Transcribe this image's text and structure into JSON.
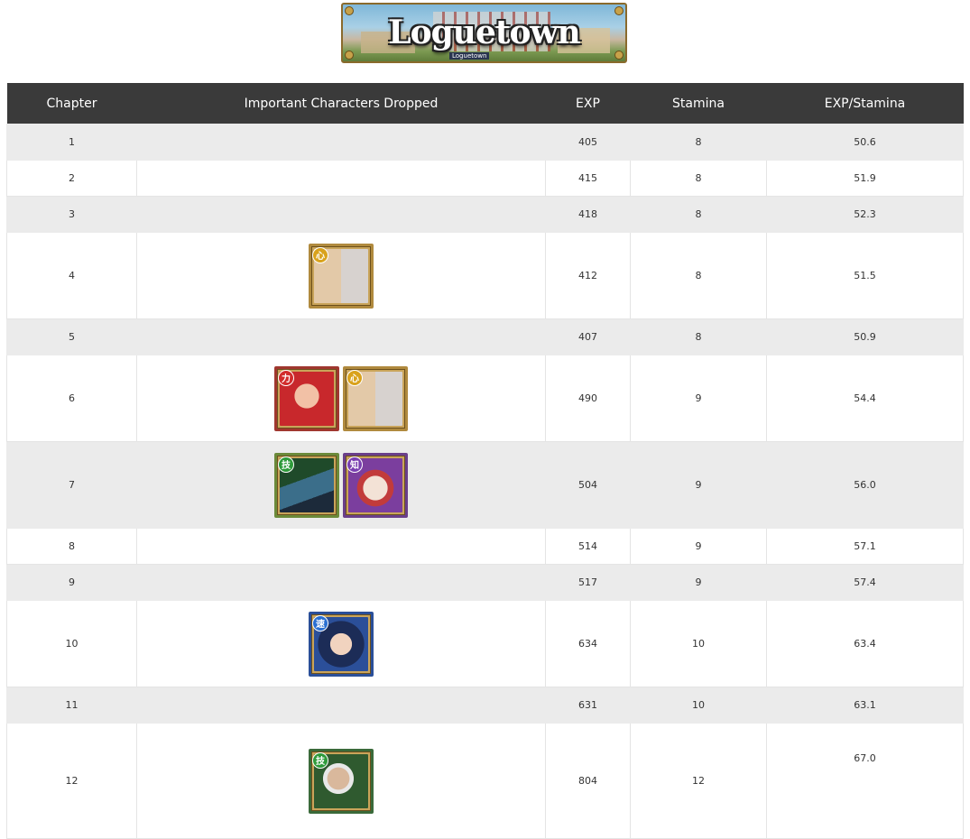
{
  "banner": {
    "title": "Loguetown",
    "subtitle": "Loguetown"
  },
  "table": {
    "headers": [
      "Chapter",
      "Important Characters Dropped",
      "EXP",
      "Stamina",
      "EXP/Stamina"
    ],
    "rows": [
      {
        "chapter": "1",
        "exp": "405",
        "stamina": "8",
        "ratio": "50.6",
        "drops": []
      },
      {
        "chapter": "2",
        "exp": "415",
        "stamina": "8",
        "ratio": "51.9",
        "drops": []
      },
      {
        "chapter": "3",
        "exp": "418",
        "stamina": "8",
        "ratio": "52.3",
        "drops": []
      },
      {
        "chapter": "4",
        "exp": "412",
        "stamina": "8",
        "ratio": "51.5",
        "drops": [
          {
            "badge": "心",
            "badge_color": "#d9a21c",
            "icon": "old-men-duo-portrait"
          }
        ]
      },
      {
        "chapter": "5",
        "exp": "407",
        "stamina": "8",
        "ratio": "50.9",
        "drops": []
      },
      {
        "chapter": "6",
        "exp": "490",
        "stamina": "9",
        "ratio": "54.4",
        "drops": [
          {
            "badge": "力",
            "badge_color": "#d22c2c",
            "icon": "alvida-portrait"
          },
          {
            "badge": "心",
            "badge_color": "#d9a21c",
            "icon": "old-men-duo-portrait"
          }
        ]
      },
      {
        "chapter": "7",
        "exp": "504",
        "stamina": "9",
        "ratio": "56.0",
        "drops": [
          {
            "badge": "技",
            "badge_color": "#2e9a3a",
            "icon": "green-haired-swordsman-portrait"
          },
          {
            "badge": "知",
            "badge_color": "#7a3fb0",
            "icon": "buggy-portrait"
          }
        ]
      },
      {
        "chapter": "8",
        "exp": "514",
        "stamina": "9",
        "ratio": "57.1",
        "drops": []
      },
      {
        "chapter": "9",
        "exp": "517",
        "stamina": "9",
        "ratio": "57.4",
        "drops": []
      },
      {
        "chapter": "10",
        "exp": "634",
        "stamina": "10",
        "ratio": "63.4",
        "drops": [
          {
            "badge": "速",
            "badge_color": "#2a6fd1",
            "icon": "tashigi-portrait"
          }
        ]
      },
      {
        "chapter": "11",
        "exp": "631",
        "stamina": "10",
        "ratio": "63.1",
        "drops": []
      },
      {
        "chapter": "12",
        "exp": "804",
        "stamina": "12",
        "ratio": "67.0",
        "drops": [
          {
            "badge": "技",
            "badge_color": "#2e9a3a",
            "icon": "smoker-portrait"
          }
        ]
      }
    ]
  }
}
